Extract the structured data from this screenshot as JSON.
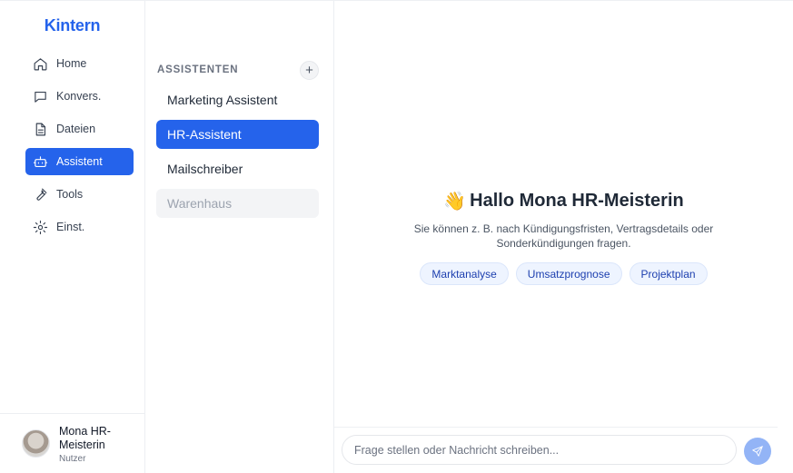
{
  "brand": {
    "name": "Kintern",
    "color": "#2563eb"
  },
  "nav": {
    "items": [
      {
        "label": "Home",
        "icon": "home-icon"
      },
      {
        "label": "Konvers.",
        "icon": "chat-icon"
      },
      {
        "label": "Dateien",
        "icon": "file-icon"
      },
      {
        "label": "Assistent",
        "icon": "bot-icon",
        "active": true
      },
      {
        "label": "Tools",
        "icon": "wrench-icon"
      },
      {
        "label": "Einst.",
        "icon": "gear-icon"
      }
    ]
  },
  "user": {
    "name": "Mona HR-Meisterin",
    "role": "Nutzer"
  },
  "assistants": {
    "title": "ASSISTENTEN",
    "add_label": "+",
    "items": [
      {
        "label": "Marketing Assistent"
      },
      {
        "label": "HR-Assistent",
        "active": true
      },
      {
        "label": "Mailschreiber"
      },
      {
        "label": "Warenhaus",
        "muted": true
      }
    ]
  },
  "welcome": {
    "emoji": "👋",
    "title": "Hallo Mona HR-Meisterin",
    "subtitle_line1": "Sie können z. B. nach Kündigungsfristen, Vertragsdetails oder",
    "subtitle_line2": "Sonderkündigungen fragen.",
    "chips": [
      "Marktanalyse",
      "Umsatzprognose",
      "Projektplan"
    ]
  },
  "composer": {
    "placeholder": "Frage stellen oder Nachricht schreiben...",
    "value": ""
  },
  "colors": {
    "accent": "#2563eb",
    "send_disabled": "#93b4f6",
    "chip_bg": "#eef4ff"
  }
}
